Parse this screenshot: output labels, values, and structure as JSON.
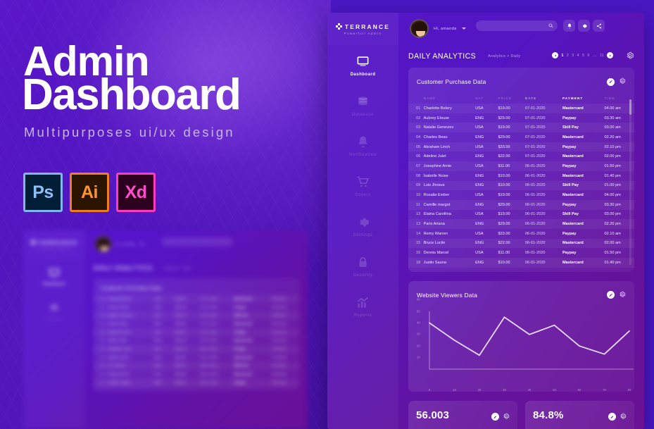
{
  "promo": {
    "title_line1": "Admin",
    "title_line2": "Dashboard",
    "subtitle": "Multipurposes ui/ux design",
    "badges": [
      {
        "label": "Ps",
        "name": "photoshop-badge"
      },
      {
        "label": "Ai",
        "name": "illustrator-badge"
      },
      {
        "label": "Xd",
        "name": "xd-badge"
      }
    ]
  },
  "dashboard": {
    "brand": {
      "name": "TERRANCE",
      "tagline": "Powerfull Admin"
    },
    "user": {
      "greeting": "Hi, amanda"
    },
    "search": {
      "placeholder": "",
      "value": ""
    },
    "topbar_icons": [
      {
        "name": "bell-icon",
        "label": "Notifications"
      },
      {
        "name": "gear-icon",
        "label": "Settings"
      },
      {
        "name": "share-icon",
        "label": "Share"
      }
    ],
    "sidebar": [
      {
        "label": "Dashboard",
        "icon": "monitor-icon",
        "active": true
      },
      {
        "label": "Database",
        "icon": "database-icon",
        "active": false
      },
      {
        "label": "Notification",
        "icon": "bell-icon",
        "active": false
      },
      {
        "label": "Orders",
        "icon": "cart-icon",
        "active": false
      },
      {
        "label": "Settings",
        "icon": "gear-icon",
        "active": false
      },
      {
        "label": "Security",
        "icon": "lock-icon",
        "active": false
      },
      {
        "label": "Reports",
        "icon": "chart-icon",
        "active": false
      }
    ],
    "page": {
      "title": "DAILY ANALYTICS",
      "breadcrumb": "Analytics > Daily",
      "pagination": [
        "1",
        "2",
        "3",
        "4",
        "5",
        "6",
        "....",
        "11"
      ],
      "pagination_active": "1"
    },
    "purchase_card": {
      "title": "Customer Purchase Data",
      "columns": [
        "NAME",
        "NAT",
        "PRICE",
        "DATE",
        "PAYMENT",
        "TIME"
      ],
      "rows": [
        {
          "idx": "01",
          "name": "Charlotte Belery",
          "nat": "USA",
          "price": "$19.00",
          "date": "07-01-2020",
          "payment": "Mastercard",
          "time": "04.00 am"
        },
        {
          "idx": "02",
          "name": "Aubrey Elouse",
          "nat": "ENG",
          "price": "$29.00",
          "date": "07-01-2020",
          "payment": "Paypay",
          "time": "03.30 am"
        },
        {
          "idx": "03",
          "name": "Natalie Geneviev",
          "nat": "USA",
          "price": "$19.00",
          "date": "07-01-2020",
          "payment": "Skill Pay",
          "time": "03.00 am"
        },
        {
          "idx": "04",
          "name": "Charles Beau",
          "nat": "ENG",
          "price": "$29.00",
          "date": "07-01-2020",
          "payment": "Mastercard",
          "time": "02.20 am"
        },
        {
          "idx": "05",
          "name": "Abraham Linch",
          "nat": "USA",
          "price": "$33.00",
          "date": "07-01-2020",
          "payment": "Paypay",
          "time": "02.10 pm"
        },
        {
          "idx": "06",
          "name": "Adeline Julet",
          "nat": "ENG",
          "price": "$22.00",
          "date": "07-01-2020",
          "payment": "Mastercard",
          "time": "02.00 pm"
        },
        {
          "idx": "07",
          "name": "Josephine Amie",
          "nat": "USA",
          "price": "$11.00",
          "date": "06-01-2020",
          "payment": "Paypay",
          "time": "01.50 pm"
        },
        {
          "idx": "08",
          "name": "Isabelle Noise",
          "nat": "ENG",
          "price": "$10.00",
          "date": "06-01-2020",
          "payment": "Mastercard",
          "time": "01.40 pm"
        },
        {
          "idx": "09",
          "name": "Luis Jhosua",
          "nat": "ENG",
          "price": "$10.00",
          "date": "06-01-2020",
          "payment": "Skill Pay",
          "time": "01.00 pm"
        },
        {
          "idx": "10",
          "name": "Rosalia Ember",
          "nat": "USA",
          "price": "$19.00",
          "date": "06-01-2020",
          "payment": "Mastercard",
          "time": "04.00 pm"
        },
        {
          "idx": "11",
          "name": "Camille margot",
          "nat": "ENG",
          "price": "$29.00",
          "date": "06-01-2020",
          "payment": "Paypay",
          "time": "03.30 pm"
        },
        {
          "idx": "12",
          "name": "Elaina Carollina",
          "nat": "USA",
          "price": "$19.00",
          "date": "06-01-2020",
          "payment": "Skill Pay",
          "time": "03.00 pm"
        },
        {
          "idx": "13",
          "name": "Paris Ariana",
          "nat": "ENG",
          "price": "$29.00",
          "date": "06-01-2020",
          "payment": "Mastercard",
          "time": "02.20 pm"
        },
        {
          "idx": "14",
          "name": "Remy Warren",
          "nat": "USA",
          "price": "$33.00",
          "date": "06-01-2020",
          "payment": "Paypay",
          "time": "02.10 am"
        },
        {
          "idx": "15",
          "name": "Bruce Lucile",
          "nat": "ENG",
          "price": "$22.00",
          "date": "06-01-2020",
          "payment": "Mastercard",
          "time": "02.00 am"
        },
        {
          "idx": "16",
          "name": "Dennis Marcel",
          "nat": "USA",
          "price": "$11.00",
          "date": "06-01-2020",
          "payment": "Paypay",
          "time": "01.50 pm"
        },
        {
          "idx": "18",
          "name": "Justin Sauna",
          "nat": "ENG",
          "price": "$10.00",
          "date": "06-01-2020",
          "payment": "Mastercard",
          "time": "01.40 pm"
        }
      ]
    },
    "viewers_card": {
      "title": "Website Viewers Data"
    },
    "stats": [
      {
        "value": "56.003",
        "name": "stat-card-visitors"
      },
      {
        "value": "84.8%",
        "name": "stat-card-rate"
      }
    ]
  },
  "chart_data": {
    "type": "line",
    "title": "Website Viewers Data",
    "xlabel": "",
    "ylabel": "",
    "x": [
      0,
      10,
      20,
      30,
      40,
      50,
      60,
      70,
      80
    ],
    "values": [
      40,
      25,
      12,
      45,
      30,
      38,
      20,
      13,
      33
    ],
    "xticks": [
      "0",
      "10",
      "20",
      "30",
      "40",
      "50",
      "60",
      "70",
      "80"
    ],
    "yticks": [
      "10",
      "20",
      "30",
      "40",
      "50",
      "60"
    ],
    "xlim": [
      0,
      80
    ],
    "ylim": [
      0,
      50
    ],
    "grid": false,
    "legend": false,
    "line_color": "#e6d9fb"
  },
  "colors": {
    "brand_purple": "#5516c8",
    "accent_magenta": "#6a1194",
    "text_light": "#ffffff",
    "muted": "#b79fe6"
  }
}
